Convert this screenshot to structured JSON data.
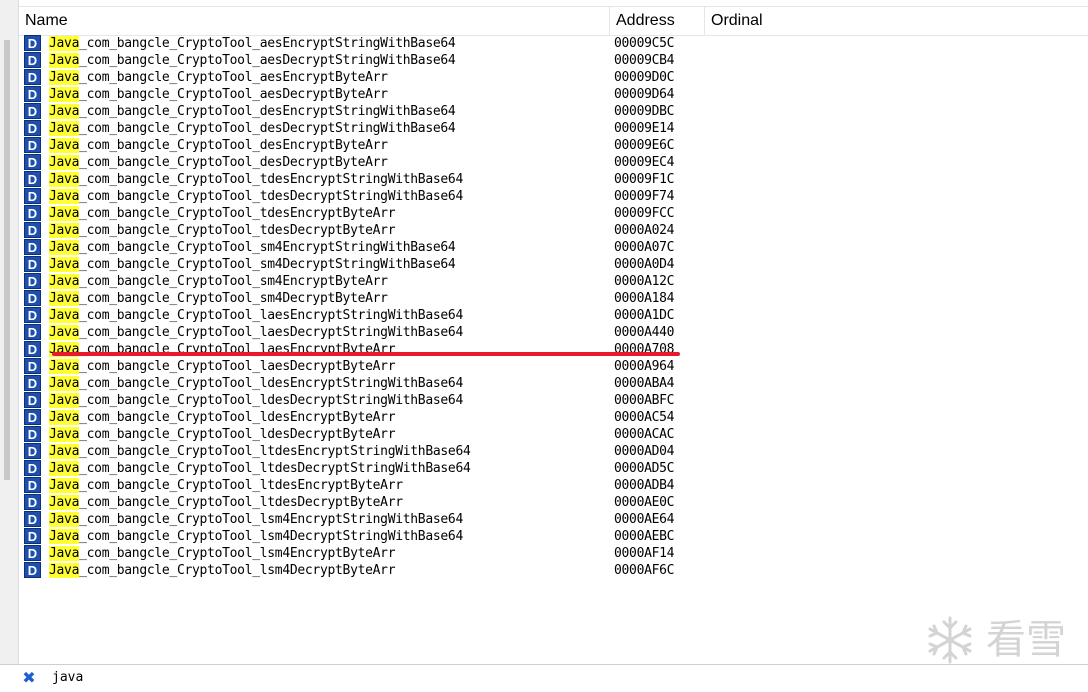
{
  "header": {
    "name": "Name",
    "address": "Address",
    "ordinal": "Ordinal"
  },
  "badge": "D",
  "highlight_term": "Java",
  "exports": [
    {
      "suffix": "_com_bangcle_CryptoTool_aesEncryptStringWithBase64",
      "address": "00009C5C"
    },
    {
      "suffix": "_com_bangcle_CryptoTool_aesDecryptStringWithBase64",
      "address": "00009CB4"
    },
    {
      "suffix": "_com_bangcle_CryptoTool_aesEncryptByteArr",
      "address": "00009D0C"
    },
    {
      "suffix": "_com_bangcle_CryptoTool_aesDecryptByteArr",
      "address": "00009D64"
    },
    {
      "suffix": "_com_bangcle_CryptoTool_desEncryptStringWithBase64",
      "address": "00009DBC"
    },
    {
      "suffix": "_com_bangcle_CryptoTool_desDecryptStringWithBase64",
      "address": "00009E14"
    },
    {
      "suffix": "_com_bangcle_CryptoTool_desEncryptByteArr",
      "address": "00009E6C"
    },
    {
      "suffix": "_com_bangcle_CryptoTool_desDecryptByteArr",
      "address": "00009EC4"
    },
    {
      "suffix": "_com_bangcle_CryptoTool_tdesEncryptStringWithBase64",
      "address": "00009F1C"
    },
    {
      "suffix": "_com_bangcle_CryptoTool_tdesDecryptStringWithBase64",
      "address": "00009F74"
    },
    {
      "suffix": "_com_bangcle_CryptoTool_tdesEncryptByteArr",
      "address": "00009FCC"
    },
    {
      "suffix": "_com_bangcle_CryptoTool_tdesDecryptByteArr",
      "address": "0000A024"
    },
    {
      "suffix": "_com_bangcle_CryptoTool_sm4EncryptStringWithBase64",
      "address": "0000A07C"
    },
    {
      "suffix": "_com_bangcle_CryptoTool_sm4DecryptStringWithBase64",
      "address": "0000A0D4"
    },
    {
      "suffix": "_com_bangcle_CryptoTool_sm4EncryptByteArr",
      "address": "0000A12C"
    },
    {
      "suffix": "_com_bangcle_CryptoTool_sm4DecryptByteArr",
      "address": "0000A184"
    },
    {
      "suffix": "_com_bangcle_CryptoTool_laesEncryptStringWithBase64",
      "address": "0000A1DC"
    },
    {
      "suffix": "_com_bangcle_CryptoTool_laesDecryptStringWithBase64",
      "address": "0000A440"
    },
    {
      "suffix": "_com_bangcle_CryptoTool_laesEncryptByteArr",
      "address": "0000A708"
    },
    {
      "suffix": "_com_bangcle_CryptoTool_laesDecryptByteArr",
      "address": "0000A964"
    },
    {
      "suffix": "_com_bangcle_CryptoTool_ldesEncryptStringWithBase64",
      "address": "0000ABA4"
    },
    {
      "suffix": "_com_bangcle_CryptoTool_ldesDecryptStringWithBase64",
      "address": "0000ABFC"
    },
    {
      "suffix": "_com_bangcle_CryptoTool_ldesEncryptByteArr",
      "address": "0000AC54"
    },
    {
      "suffix": "_com_bangcle_CryptoTool_ldesDecryptByteArr",
      "address": "0000ACAC"
    },
    {
      "suffix": "_com_bangcle_CryptoTool_ltdesEncryptStringWithBase64",
      "address": "0000AD04"
    },
    {
      "suffix": "_com_bangcle_CryptoTool_ltdesDecryptStringWithBase64",
      "address": "0000AD5C"
    },
    {
      "suffix": "_com_bangcle_CryptoTool_ltdesEncryptByteArr",
      "address": "0000ADB4"
    },
    {
      "suffix": "_com_bangcle_CryptoTool_ltdesDecryptByteArr",
      "address": "0000AE0C"
    },
    {
      "suffix": "_com_bangcle_CryptoTool_lsm4EncryptStringWithBase64",
      "address": "0000AE64"
    },
    {
      "suffix": "_com_bangcle_CryptoTool_lsm4DecryptStringWithBase64",
      "address": "0000AEBC"
    },
    {
      "suffix": "_com_bangcle_CryptoTool_lsm4EncryptByteArr",
      "address": "0000AF14"
    },
    {
      "suffix": "_com_bangcle_CryptoTool_lsm4DecryptByteArr",
      "address": "0000AF6C"
    }
  ],
  "filter": {
    "value": "java"
  },
  "watermark": {
    "text": "看雪"
  },
  "colors": {
    "highlight": "#ffff33",
    "badge": "#1e4fae",
    "annotation_line": "#e8192c",
    "close_icon": "#1e5fd6"
  }
}
